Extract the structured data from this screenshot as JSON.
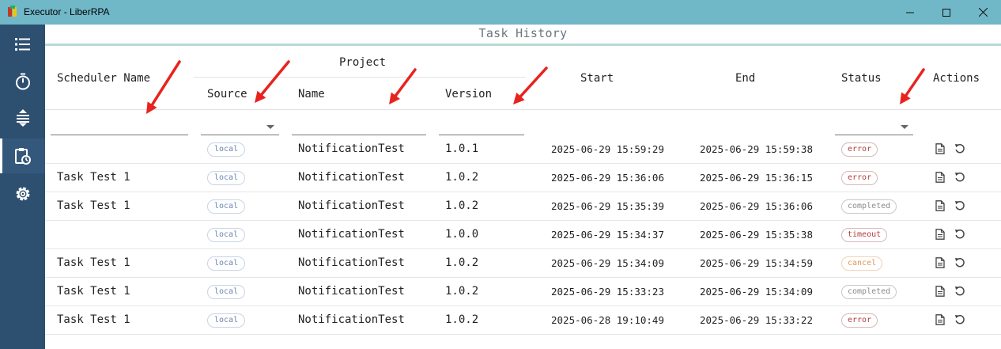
{
  "window": {
    "title": "Executor - LiberRPA"
  },
  "nav": {
    "items": [
      "list-icon",
      "timer-icon",
      "queue-icon",
      "history-icon",
      "settings-icon"
    ],
    "active": 3
  },
  "page": {
    "title": "Task History"
  },
  "headers": {
    "scheduler_name": "Scheduler Name",
    "project": "Project",
    "source": "Source",
    "name": "Name",
    "version": "Version",
    "start": "Start",
    "end": "End",
    "status": "Status",
    "actions": "Actions"
  },
  "rows": [
    {
      "scheduler": "",
      "source": "local",
      "name": "NotificationTest",
      "version": "1.0.1",
      "start": "2025-06-29 15:59:29",
      "end": "2025-06-29 15:59:38",
      "status": "error"
    },
    {
      "scheduler": "Task Test 1",
      "source": "local",
      "name": "NotificationTest",
      "version": "1.0.2",
      "start": "2025-06-29 15:36:06",
      "end": "2025-06-29 15:36:15",
      "status": "error"
    },
    {
      "scheduler": "Task Test 1",
      "source": "local",
      "name": "NotificationTest",
      "version": "1.0.2",
      "start": "2025-06-29 15:35:39",
      "end": "2025-06-29 15:36:06",
      "status": "completed"
    },
    {
      "scheduler": "",
      "source": "local",
      "name": "NotificationTest",
      "version": "1.0.0",
      "start": "2025-06-29 15:34:37",
      "end": "2025-06-29 15:35:38",
      "status": "timeout"
    },
    {
      "scheduler": "Task Test 1",
      "source": "local",
      "name": "NotificationTest",
      "version": "1.0.2",
      "start": "2025-06-29 15:34:09",
      "end": "2025-06-29 15:34:59",
      "status": "cancel"
    },
    {
      "scheduler": "Task Test 1",
      "source": "local",
      "name": "NotificationTest",
      "version": "1.0.2",
      "start": "2025-06-29 15:33:23",
      "end": "2025-06-29 15:34:09",
      "status": "completed"
    },
    {
      "scheduler": "Task Test 1",
      "source": "local",
      "name": "NotificationTest",
      "version": "1.0.2",
      "start": "2025-06-28 19:10:49",
      "end": "2025-06-29 15:33:22",
      "status": "error"
    }
  ],
  "status_colors": {
    "error": "#b0413e",
    "completed": "#8a8a8a",
    "timeout": "#b0413e",
    "cancel": "#e0935a"
  },
  "status_borders": {
    "error": "#d9b8b8",
    "completed": "#c8c8c8",
    "timeout": "#d9b8b8",
    "cancel": "#f0d2b8"
  },
  "actions": [
    "log-icon",
    "rerun-icon"
  ],
  "annotation_color": "#e8231f"
}
